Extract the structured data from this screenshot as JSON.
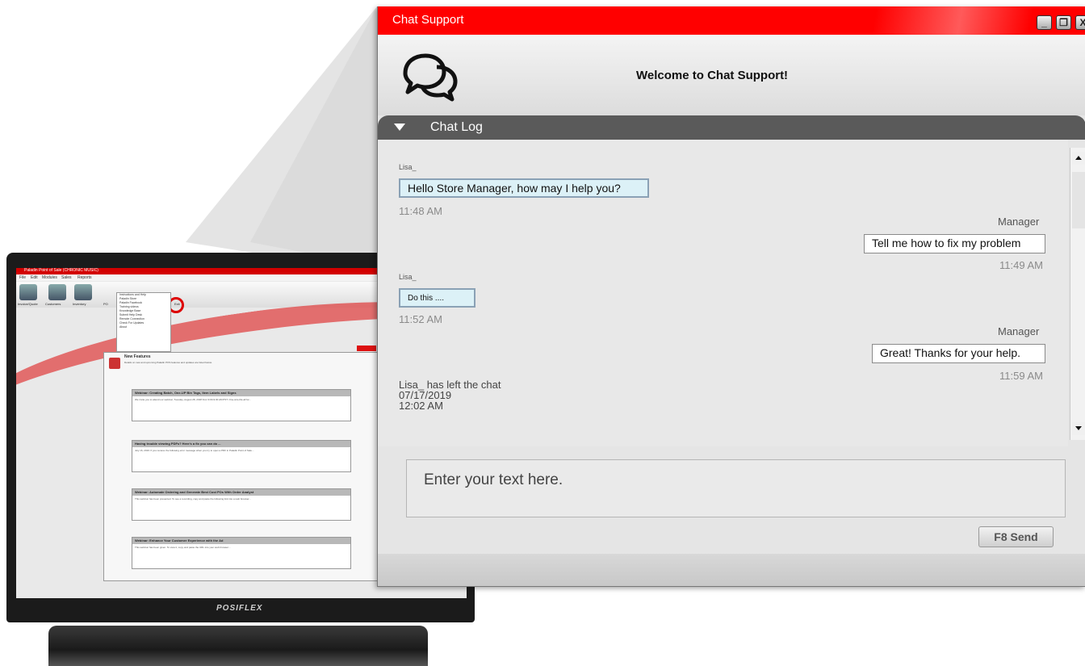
{
  "background_screen": {
    "title": "Paladin Point of Sale  (CHRONIC MUSIC)",
    "menu": [
      "File",
      "Edit",
      "Modules",
      "Sales",
      "Reports"
    ],
    "toolbar_labels": [
      "Invoice/Quote",
      "Customers",
      "Inventory",
      "PO",
      "Exit"
    ],
    "dropdown_items": [
      "Instructions and Help",
      "Paladin Store",
      "Paladin Facebook",
      "Training videos",
      "Knowledge Base",
      "Submit Help Desk",
      "Remote Connection",
      "Check For Updates",
      "About"
    ],
    "panel_title": "New Features",
    "panel_subtitle": "Details on new and upcoming Paladin POS features and updates are listed below.",
    "cards": [
      {
        "title": "Webinar: Creating Batch, One-UP Bin Tags, Item Labels and Signs",
        "body": "We invite you to attend our webinar, Tuesday, August 28, 2018 from 9:00-9:30 AM PST. One-size-fits-all for..."
      },
      {
        "title": "Having trouble viewing PDFs? Here's a fix you can do ...",
        "body": "July 16, 2019: If you receive the following error message when you try to open a PDF in Paladin Point of Sale..."
      },
      {
        "title": "Webinar: Automate Ordering and Generate Best Cost POs With Order Analyst",
        "body": "This webinar has been presented. To see a recording, copy and paste the following link into a web browser..."
      },
      {
        "title": "Webinar: Enhance Your Customer Experience with the Ad",
        "body": "This webinar has been given. To view it, copy and paste the URL into your web browser..."
      }
    ],
    "brand": "POSIFLEX"
  },
  "chat": {
    "window_title": "Chat Support",
    "window_buttons": {
      "minimize": "_",
      "maximize": "❐",
      "close": "X"
    },
    "welcome": "Welcome to Chat Support!",
    "log_title": "Chat Log",
    "messages": [
      {
        "sender": "Lisa_",
        "text": "Hello Store Manager, how may I help you?",
        "time": "11:48 AM",
        "direction": "incoming"
      },
      {
        "sender": "Manager",
        "text": "Tell me how to fix my problem",
        "time": "11:49 AM",
        "direction": "outgoing"
      },
      {
        "sender": "Lisa_",
        "text": "Do this ....",
        "time": "11:52 AM",
        "direction": "incoming"
      },
      {
        "sender": "Manager",
        "text": "Great! Thanks for your help.",
        "time": "11:59 AM",
        "direction": "outgoing"
      }
    ],
    "system_message": {
      "line1": "Lisa_ has left the chat",
      "line2": "07/17/2019",
      "line3": "12:02 AM"
    },
    "input_placeholder": "Enter your text here.",
    "send_label": "F8 Send"
  },
  "colors": {
    "title_bar": "#ff0000",
    "log_header": "#5a5a5a",
    "incoming_bubble": "#dcf1f7"
  }
}
